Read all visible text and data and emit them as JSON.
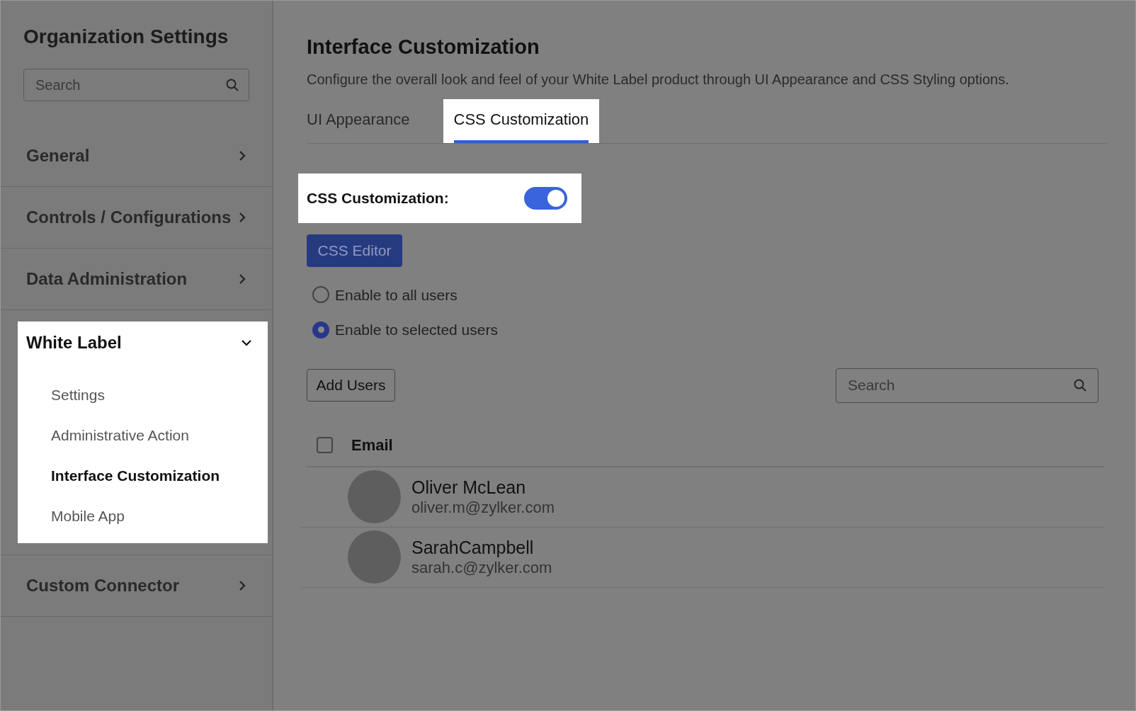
{
  "sidebar": {
    "title": "Organization Settings",
    "search": {
      "placeholder": "Search"
    },
    "items": [
      {
        "label": "General",
        "expanded": false
      },
      {
        "label": "Controls / Configurations",
        "expanded": false
      },
      {
        "label": "Data Administration",
        "expanded": false
      },
      {
        "label": "White Label",
        "expanded": true,
        "children": [
          {
            "label": "Settings",
            "selected": false
          },
          {
            "label": "Administrative Action",
            "selected": false
          },
          {
            "label": "Interface Customization",
            "selected": true
          },
          {
            "label": "Mobile App",
            "selected": false
          }
        ]
      },
      {
        "label": "Custom Connector",
        "expanded": false
      }
    ]
  },
  "main": {
    "title": "Interface Customization",
    "description": "Configure the overall look and feel of your White Label product through UI Appearance and CSS Styling options.",
    "tabs": [
      {
        "label": "UI Appearance",
        "selected": false
      },
      {
        "label": "CSS Customization",
        "selected": true
      }
    ],
    "toggle": {
      "label": "CSS Customization:",
      "on": true
    },
    "editor_button": "CSS Editor",
    "radios": [
      {
        "label": "Enable to all users",
        "selected": false
      },
      {
        "label": "Enable to selected users",
        "selected": true
      }
    ],
    "add_button": "Add Users",
    "search": {
      "placeholder": "Search"
    },
    "table": {
      "select_all_checked": false,
      "column": "Email",
      "rows": [
        {
          "name": "Oliver McLean",
          "email": "oliver.m@zylker.com"
        },
        {
          "name": "SarahCampbell",
          "email": "sarah.c@zylker.com"
        }
      ]
    }
  }
}
